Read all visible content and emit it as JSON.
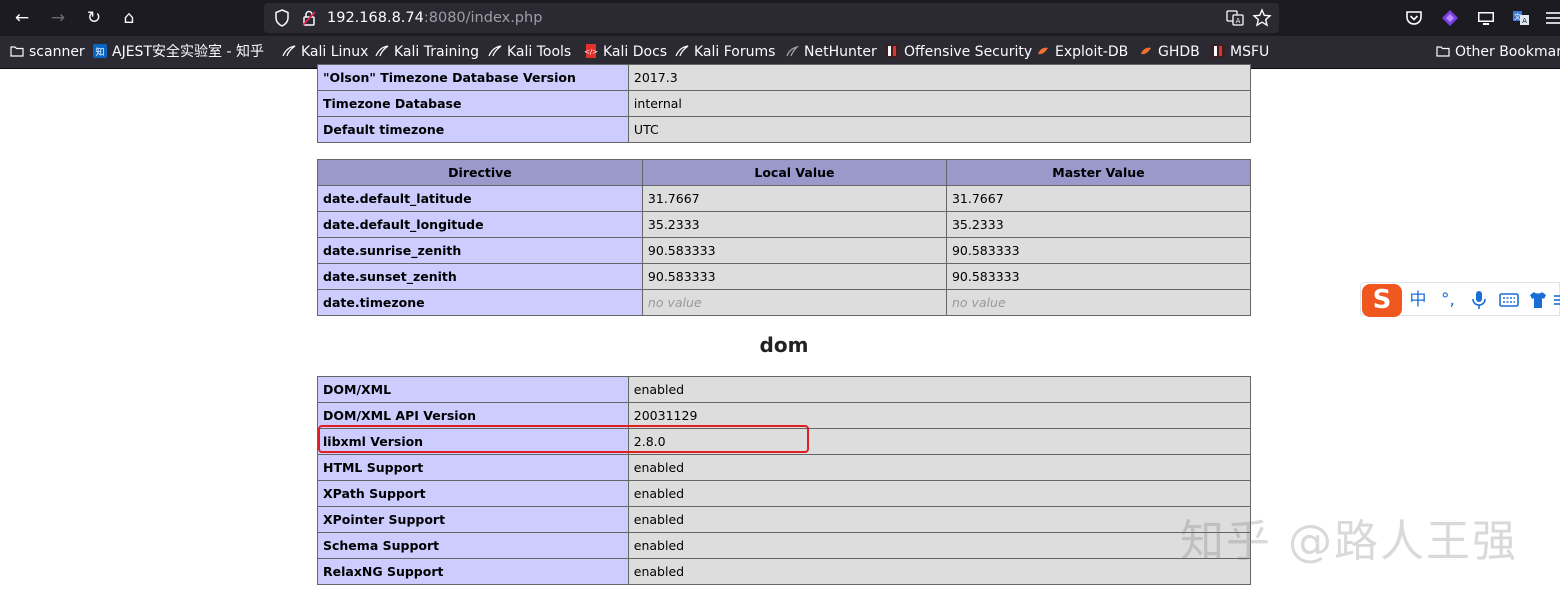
{
  "browser": {
    "nav": {
      "back_icon": "←",
      "forward_icon": "→",
      "reload_icon": "↻",
      "home_icon": "⌂"
    },
    "url": {
      "host": "192.168.8.74",
      "rest": ":8080/index.php"
    },
    "bookmarks": [
      {
        "label": "scanner",
        "icon": "folder-icon"
      },
      {
        "label": "AJEST安全实验室 - 知乎",
        "icon": "zhihu-icon"
      },
      {
        "label": "Kali Linux",
        "icon": "kali-icon"
      },
      {
        "label": "Kali Training",
        "icon": "kali-icon"
      },
      {
        "label": "Kali Tools",
        "icon": "kali-icon"
      },
      {
        "label": "Kali Docs",
        "icon": "kali-docs-icon"
      },
      {
        "label": "Kali Forums",
        "icon": "kali-icon"
      },
      {
        "label": "NetHunter",
        "icon": "nethunter-icon"
      },
      {
        "label": "Offensive Security",
        "icon": "offsec-icon"
      },
      {
        "label": "Exploit-DB",
        "icon": "exploitdb-icon"
      },
      {
        "label": "GHDB",
        "icon": "exploitdb-icon"
      },
      {
        "label": "MSFU",
        "icon": "offsec-icon"
      },
      {
        "label": "Other Bookmark",
        "icon": "folder-icon"
      }
    ]
  },
  "timezone_table": [
    {
      "key": "\"Olson\" Timezone Database Version",
      "value": "2017.3"
    },
    {
      "key": "Timezone Database",
      "value": "internal"
    },
    {
      "key": "Default timezone",
      "value": "UTC"
    }
  ],
  "date_table": {
    "headers": [
      "Directive",
      "Local Value",
      "Master Value"
    ],
    "rows": [
      {
        "directive": "date.default_latitude",
        "local": "31.7667",
        "master": "31.7667"
      },
      {
        "directive": "date.default_longitude",
        "local": "35.2333",
        "master": "35.2333"
      },
      {
        "directive": "date.sunrise_zenith",
        "local": "90.583333",
        "master": "90.583333"
      },
      {
        "directive": "date.sunset_zenith",
        "local": "90.583333",
        "master": "90.583333"
      },
      {
        "directive": "date.timezone",
        "local": "no value",
        "master": "no value"
      }
    ]
  },
  "dom_section": {
    "heading": "dom",
    "rows": [
      {
        "key": "DOM/XML",
        "value": "enabled"
      },
      {
        "key": "DOM/XML API Version",
        "value": "20031129"
      },
      {
        "key": "libxml Version",
        "value": "2.8.0"
      },
      {
        "key": "HTML Support",
        "value": "enabled"
      },
      {
        "key": "XPath Support",
        "value": "enabled"
      },
      {
        "key": "XPointer Support",
        "value": "enabled"
      },
      {
        "key": "Schema Support",
        "value": "enabled"
      },
      {
        "key": "RelaxNG Support",
        "value": "enabled"
      }
    ]
  },
  "ime": {
    "logo": "S",
    "mode": "中",
    "punct": "°,",
    "mic_icon": "microphone-icon",
    "keyboard_icon": "keyboard-icon",
    "skin_icon": "shirt-icon"
  },
  "watermark": "知乎 @路人王强",
  "colors": {
    "highlight": "#e02020",
    "header_bg": "#9999cc",
    "key_bg": "#ccccff",
    "value_bg": "#dddddd"
  }
}
